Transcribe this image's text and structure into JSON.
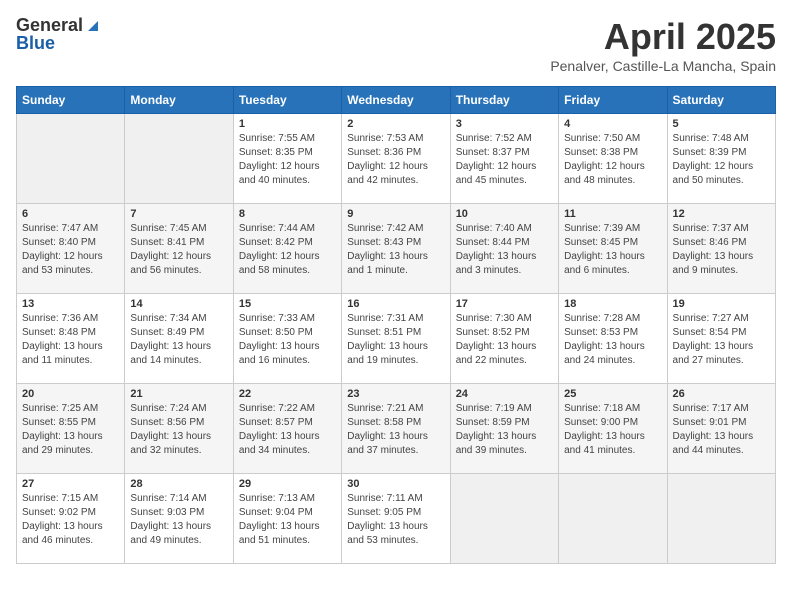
{
  "header": {
    "logo_general": "General",
    "logo_blue": "Blue",
    "title": "April 2025",
    "location": "Penalver, Castille-La Mancha, Spain"
  },
  "weekdays": [
    "Sunday",
    "Monday",
    "Tuesday",
    "Wednesday",
    "Thursday",
    "Friday",
    "Saturday"
  ],
  "weeks": [
    [
      {
        "day": "",
        "sunrise": "",
        "sunset": "",
        "daylight": ""
      },
      {
        "day": "",
        "sunrise": "",
        "sunset": "",
        "daylight": ""
      },
      {
        "day": "1",
        "sunrise": "Sunrise: 7:55 AM",
        "sunset": "Sunset: 8:35 PM",
        "daylight": "Daylight: 12 hours and 40 minutes."
      },
      {
        "day": "2",
        "sunrise": "Sunrise: 7:53 AM",
        "sunset": "Sunset: 8:36 PM",
        "daylight": "Daylight: 12 hours and 42 minutes."
      },
      {
        "day": "3",
        "sunrise": "Sunrise: 7:52 AM",
        "sunset": "Sunset: 8:37 PM",
        "daylight": "Daylight: 12 hours and 45 minutes."
      },
      {
        "day": "4",
        "sunrise": "Sunrise: 7:50 AM",
        "sunset": "Sunset: 8:38 PM",
        "daylight": "Daylight: 12 hours and 48 minutes."
      },
      {
        "day": "5",
        "sunrise": "Sunrise: 7:48 AM",
        "sunset": "Sunset: 8:39 PM",
        "daylight": "Daylight: 12 hours and 50 minutes."
      }
    ],
    [
      {
        "day": "6",
        "sunrise": "Sunrise: 7:47 AM",
        "sunset": "Sunset: 8:40 PM",
        "daylight": "Daylight: 12 hours and 53 minutes."
      },
      {
        "day": "7",
        "sunrise": "Sunrise: 7:45 AM",
        "sunset": "Sunset: 8:41 PM",
        "daylight": "Daylight: 12 hours and 56 minutes."
      },
      {
        "day": "8",
        "sunrise": "Sunrise: 7:44 AM",
        "sunset": "Sunset: 8:42 PM",
        "daylight": "Daylight: 12 hours and 58 minutes."
      },
      {
        "day": "9",
        "sunrise": "Sunrise: 7:42 AM",
        "sunset": "Sunset: 8:43 PM",
        "daylight": "Daylight: 13 hours and 1 minute."
      },
      {
        "day": "10",
        "sunrise": "Sunrise: 7:40 AM",
        "sunset": "Sunset: 8:44 PM",
        "daylight": "Daylight: 13 hours and 3 minutes."
      },
      {
        "day": "11",
        "sunrise": "Sunrise: 7:39 AM",
        "sunset": "Sunset: 8:45 PM",
        "daylight": "Daylight: 13 hours and 6 minutes."
      },
      {
        "day": "12",
        "sunrise": "Sunrise: 7:37 AM",
        "sunset": "Sunset: 8:46 PM",
        "daylight": "Daylight: 13 hours and 9 minutes."
      }
    ],
    [
      {
        "day": "13",
        "sunrise": "Sunrise: 7:36 AM",
        "sunset": "Sunset: 8:48 PM",
        "daylight": "Daylight: 13 hours and 11 minutes."
      },
      {
        "day": "14",
        "sunrise": "Sunrise: 7:34 AM",
        "sunset": "Sunset: 8:49 PM",
        "daylight": "Daylight: 13 hours and 14 minutes."
      },
      {
        "day": "15",
        "sunrise": "Sunrise: 7:33 AM",
        "sunset": "Sunset: 8:50 PM",
        "daylight": "Daylight: 13 hours and 16 minutes."
      },
      {
        "day": "16",
        "sunrise": "Sunrise: 7:31 AM",
        "sunset": "Sunset: 8:51 PM",
        "daylight": "Daylight: 13 hours and 19 minutes."
      },
      {
        "day": "17",
        "sunrise": "Sunrise: 7:30 AM",
        "sunset": "Sunset: 8:52 PM",
        "daylight": "Daylight: 13 hours and 22 minutes."
      },
      {
        "day": "18",
        "sunrise": "Sunrise: 7:28 AM",
        "sunset": "Sunset: 8:53 PM",
        "daylight": "Daylight: 13 hours and 24 minutes."
      },
      {
        "day": "19",
        "sunrise": "Sunrise: 7:27 AM",
        "sunset": "Sunset: 8:54 PM",
        "daylight": "Daylight: 13 hours and 27 minutes."
      }
    ],
    [
      {
        "day": "20",
        "sunrise": "Sunrise: 7:25 AM",
        "sunset": "Sunset: 8:55 PM",
        "daylight": "Daylight: 13 hours and 29 minutes."
      },
      {
        "day": "21",
        "sunrise": "Sunrise: 7:24 AM",
        "sunset": "Sunset: 8:56 PM",
        "daylight": "Daylight: 13 hours and 32 minutes."
      },
      {
        "day": "22",
        "sunrise": "Sunrise: 7:22 AM",
        "sunset": "Sunset: 8:57 PM",
        "daylight": "Daylight: 13 hours and 34 minutes."
      },
      {
        "day": "23",
        "sunrise": "Sunrise: 7:21 AM",
        "sunset": "Sunset: 8:58 PM",
        "daylight": "Daylight: 13 hours and 37 minutes."
      },
      {
        "day": "24",
        "sunrise": "Sunrise: 7:19 AM",
        "sunset": "Sunset: 8:59 PM",
        "daylight": "Daylight: 13 hours and 39 minutes."
      },
      {
        "day": "25",
        "sunrise": "Sunrise: 7:18 AM",
        "sunset": "Sunset: 9:00 PM",
        "daylight": "Daylight: 13 hours and 41 minutes."
      },
      {
        "day": "26",
        "sunrise": "Sunrise: 7:17 AM",
        "sunset": "Sunset: 9:01 PM",
        "daylight": "Daylight: 13 hours and 44 minutes."
      }
    ],
    [
      {
        "day": "27",
        "sunrise": "Sunrise: 7:15 AM",
        "sunset": "Sunset: 9:02 PM",
        "daylight": "Daylight: 13 hours and 46 minutes."
      },
      {
        "day": "28",
        "sunrise": "Sunrise: 7:14 AM",
        "sunset": "Sunset: 9:03 PM",
        "daylight": "Daylight: 13 hours and 49 minutes."
      },
      {
        "day": "29",
        "sunrise": "Sunrise: 7:13 AM",
        "sunset": "Sunset: 9:04 PM",
        "daylight": "Daylight: 13 hours and 51 minutes."
      },
      {
        "day": "30",
        "sunrise": "Sunrise: 7:11 AM",
        "sunset": "Sunset: 9:05 PM",
        "daylight": "Daylight: 13 hours and 53 minutes."
      },
      {
        "day": "",
        "sunrise": "",
        "sunset": "",
        "daylight": ""
      },
      {
        "day": "",
        "sunrise": "",
        "sunset": "",
        "daylight": ""
      },
      {
        "day": "",
        "sunrise": "",
        "sunset": "",
        "daylight": ""
      }
    ]
  ]
}
